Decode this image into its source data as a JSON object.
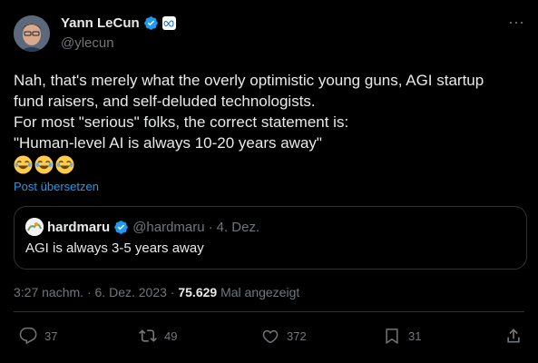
{
  "author": {
    "name": "Yann LeCun",
    "handle": "@ylecun",
    "verified_icon": "verified-badge-icon",
    "affiliate_icon": "meta-logo-icon"
  },
  "tweet": {
    "lines": [
      "Nah, that's merely what the overly optimistic young guns, AGI startup",
      "fund raisers, and self-deluded technologists.",
      "For most \"serious\" folks, the correct statement is:",
      "\"Human-level AI is always 10-20 years away\""
    ],
    "emojis": [
      "😂",
      "😂",
      "😂"
    ],
    "translate_label": "Post übersetzen"
  },
  "quote": {
    "name": "hardmaru",
    "handle": "@hardmaru",
    "separator": "·",
    "date": "4. Dez.",
    "text": "AGI is always 3-5 years away"
  },
  "meta": {
    "time": "3:27 nachm.",
    "separator1": "·",
    "date": "6. Dez. 2023",
    "separator2": "·",
    "views": "75.629",
    "views_label": "Mal angezeigt"
  },
  "actions": {
    "replies": "37",
    "reposts": "49",
    "likes": "372",
    "bookmarks": "31"
  },
  "colors": {
    "background": "#000000",
    "text": "#e7e9ea",
    "muted": "#71767b",
    "accent": "#1d9bf0",
    "border": "#2f3336"
  }
}
